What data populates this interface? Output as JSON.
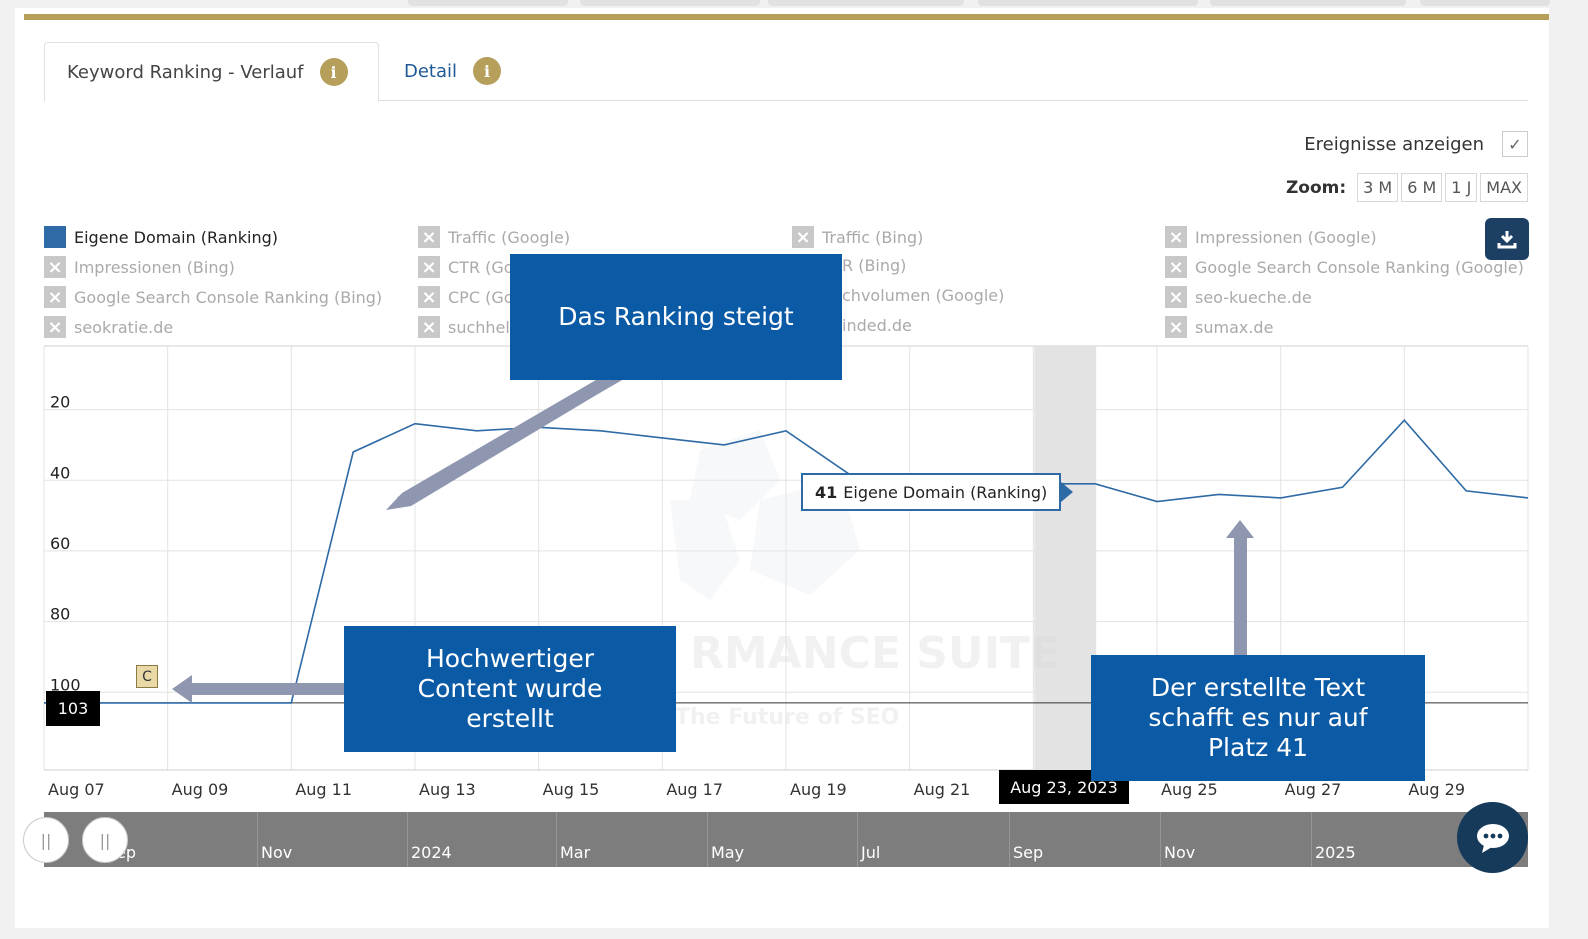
{
  "tabs": [
    {
      "label": "Keyword Ranking - Verlauf",
      "active": true
    },
    {
      "label": "Detail",
      "active": false
    }
  ],
  "events_toggle": {
    "label": "Ereignisse anzeigen",
    "checked": true
  },
  "zoom": {
    "label": "Zoom:",
    "options": [
      "3 M",
      "6 M",
      "1 J",
      "MAX"
    ]
  },
  "legend": [
    {
      "label": "Eigene Domain (Ranking)",
      "enabled": true
    },
    {
      "label": "Traffic (Google)",
      "enabled": false
    },
    {
      "label": "Traffic (Bing)",
      "enabled": false
    },
    {
      "label": "Impressionen (Google)",
      "enabled": false
    },
    {
      "label": "Impressionen (Bing)",
      "enabled": false
    },
    {
      "label": "CTR (Go",
      "enabled": false
    },
    {
      "label": "R (Bing)",
      "enabled": false
    },
    {
      "label": "Google Search Console Ranking (Google)",
      "enabled": false
    },
    {
      "label": "Google Search Console Ranking (Bing)",
      "enabled": false
    },
    {
      "label": "CPC (Go",
      "enabled": false
    },
    {
      "label": "chvolumen (Google)",
      "enabled": false
    },
    {
      "label": "seo-kueche.de",
      "enabled": false
    },
    {
      "label": "seokratie.de",
      "enabled": false
    },
    {
      "label": "suchhel",
      "enabled": false
    },
    {
      "label": "inded.de",
      "enabled": false
    },
    {
      "label": "sumax.de",
      "enabled": false
    }
  ],
  "tooltip": {
    "value": "41",
    "series": "Eigene Domain (Ranking)"
  },
  "crosshair_x_label": "Aug 23, 2023",
  "crosshair_y_label": "103",
  "event_marker": "C",
  "watermark": {
    "main": "RMANCE SUITE",
    "sub": "The Future of SEO"
  },
  "navigator": {
    "labels": [
      "ep",
      "Nov",
      "2024",
      "Mar",
      "May",
      "Jul",
      "Sep",
      "Nov",
      "2025"
    ]
  },
  "callouts": {
    "top": "Das Ranking steigt",
    "left": "Hochwertiger Content wurde erstellt",
    "right": "Der erstellte Text schafft es nur auf Platz 41"
  },
  "colors": {
    "accent_gold": "#b59f5a",
    "series_blue": "#2e6aa5",
    "callout_blue": "#0b5aa5",
    "navy": "#1c3f63"
  },
  "chart_data": {
    "type": "line",
    "x": [
      "Aug 07",
      "Aug 08",
      "Aug 09",
      "Aug 10",
      "Aug 11",
      "Aug 12",
      "Aug 13",
      "Aug 14",
      "Aug 15",
      "Aug 16",
      "Aug 17",
      "Aug 18",
      "Aug 19",
      "Aug 20",
      "Aug 21",
      "Aug 22",
      "Aug 23",
      "Aug 24",
      "Aug 25",
      "Aug 26",
      "Aug 27",
      "Aug 28",
      "Aug 29",
      "Aug 30",
      "Aug 31"
    ],
    "x_tick_labels": [
      "Aug 07",
      "Aug 09",
      "Aug 11",
      "Aug 13",
      "Aug 15",
      "Aug 17",
      "Aug 19",
      "Aug 21",
      "Aug 23",
      "Aug 25",
      "Aug 27",
      "Aug 29"
    ],
    "series": [
      {
        "name": "Eigene Domain (Ranking)",
        "values": [
          103,
          103,
          103,
          103,
          103,
          32,
          24,
          26,
          25,
          26,
          28,
          30,
          26,
          38,
          47,
          44,
          41,
          41,
          46,
          44,
          45,
          42,
          23,
          43,
          45
        ]
      }
    ],
    "y_ticks": [
      20,
      40,
      60,
      80,
      100
    ],
    "ylim": [
      2,
      122
    ],
    "y_reversed": true,
    "grid": true,
    "highlight_band": {
      "from": "Aug 23",
      "to": "Aug 24"
    }
  }
}
